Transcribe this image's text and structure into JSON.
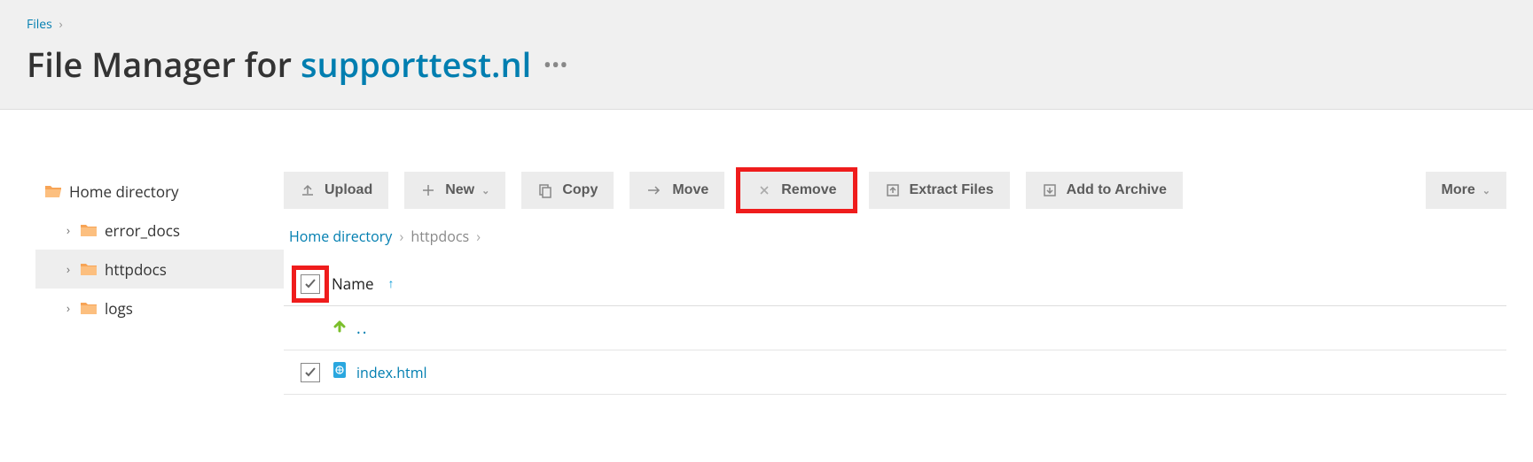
{
  "breadcrumb_top": {
    "label": "Files"
  },
  "page_title": {
    "prefix": "File Manager for",
    "domain": "supporttest.nl"
  },
  "sidebar": {
    "root": {
      "label": "Home directory"
    },
    "items": [
      {
        "label": "error_docs"
      },
      {
        "label": "httpdocs"
      },
      {
        "label": "logs"
      }
    ]
  },
  "toolbar": {
    "upload": "Upload",
    "new": "New",
    "copy": "Copy",
    "move": "Move",
    "remove": "Remove",
    "extract": "Extract Files",
    "archive": "Add to Archive",
    "more": "More"
  },
  "path": {
    "root": "Home directory",
    "current": "httpdocs"
  },
  "table": {
    "column_name": "Name",
    "parent_dots": "..",
    "rows": [
      {
        "name": "index.html",
        "checked": true
      }
    ]
  }
}
